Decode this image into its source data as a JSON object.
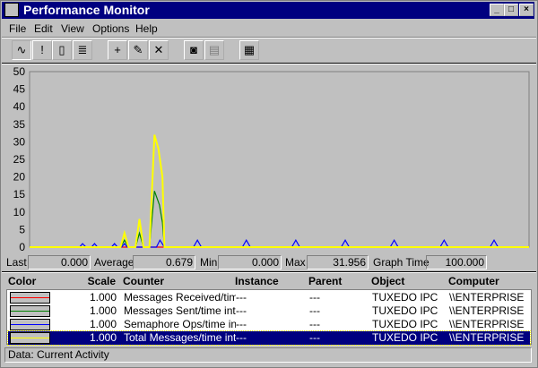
{
  "window": {
    "title": "Performance Monitor",
    "controls": [
      "_",
      "□",
      "×"
    ]
  },
  "menu": [
    "File",
    "Edit",
    "View",
    "Options",
    "Help"
  ],
  "toolbar": [
    {
      "name": "chart-view"
    },
    {
      "name": "alert-view"
    },
    {
      "name": "log-view"
    },
    {
      "name": "report-view"
    },
    {
      "name": "add-counter",
      "glyph": "+"
    },
    {
      "name": "edit-counter"
    },
    {
      "name": "delete-counter",
      "glyph": "✕"
    },
    {
      "name": "update-now"
    },
    {
      "name": "bookmark"
    },
    {
      "name": "options"
    }
  ],
  "stats": {
    "last_label": "Last",
    "last": "0.000",
    "average_label": "Average",
    "average": "0.679",
    "min_label": "Min",
    "min": "0.000",
    "max_label": "Max",
    "max": "31.956",
    "graph_time_label": "Graph Time",
    "graph_time": "100.000"
  },
  "legend": {
    "headers": {
      "color": "Color",
      "scale": "Scale",
      "counter": "Counter",
      "instance": "Instance",
      "parent": "Parent",
      "object": "Object",
      "computer": "Computer"
    },
    "rows": [
      {
        "color": "#ff0000",
        "scale": "1.000",
        "counter": "Messages Received/time",
        "instance": "---",
        "parent": "---",
        "object": "TUXEDO IPC",
        "computer": "\\\\ENTERPRISE"
      },
      {
        "color": "#008000",
        "scale": "1.000",
        "counter": "Messages Sent/time interv",
        "instance": "---",
        "parent": "---",
        "object": "TUXEDO IPC",
        "computer": "\\\\ENTERPRISE"
      },
      {
        "color": "#0000ff",
        "scale": "1.000",
        "counter": "Semaphore Ops/time inter",
        "instance": "---",
        "parent": "---",
        "object": "TUXEDO IPC",
        "computer": "\\\\ENTERPRISE"
      },
      {
        "color": "#ffff00",
        "scale": "1.000",
        "counter": "Total Messages/time inter",
        "instance": "---",
        "parent": "---",
        "object": "TUXEDO IPC",
        "computer": "\\\\ENTERPRISE",
        "selected": true
      }
    ]
  },
  "status": "Data: Current Activity",
  "chart_data": {
    "type": "line",
    "ylim": [
      0,
      50
    ],
    "xlim": [
      0,
      100
    ],
    "yticks": [
      "0",
      "5",
      "10",
      "15",
      "20",
      "25",
      "30",
      "35",
      "40",
      "45",
      "50"
    ],
    "series": [
      {
        "name": "Messages Received/time",
        "color": "#ff0000",
        "points": [
          [
            0,
            0
          ],
          [
            100,
            0
          ]
        ]
      },
      {
        "name": "Semaphore Ops/time",
        "color": "#0000ff",
        "points": [
          [
            0,
            0
          ],
          [
            10,
            0
          ],
          [
            10.6,
            1
          ],
          [
            11.3,
            0
          ],
          [
            12.4,
            0
          ],
          [
            13,
            1
          ],
          [
            13.6,
            0
          ],
          [
            16.4,
            0
          ],
          [
            17,
            1
          ],
          [
            17.6,
            0
          ],
          [
            18.4,
            0
          ],
          [
            19,
            1
          ],
          [
            19.6,
            0
          ],
          [
            25.4,
            0
          ],
          [
            26.1,
            2
          ],
          [
            27,
            0
          ],
          [
            32.8,
            0
          ],
          [
            33.6,
            2
          ],
          [
            34.4,
            0
          ],
          [
            42.6,
            0
          ],
          [
            43.4,
            2
          ],
          [
            44.2,
            0
          ],
          [
            52.5,
            0
          ],
          [
            53.3,
            2
          ],
          [
            54.1,
            0
          ],
          [
            62.4,
            0
          ],
          [
            63.2,
            2
          ],
          [
            64,
            0
          ],
          [
            72.2,
            0
          ],
          [
            73,
            2
          ],
          [
            73.8,
            0
          ],
          [
            82.2,
            0
          ],
          [
            83,
            2
          ],
          [
            83.8,
            0
          ],
          [
            92.2,
            0
          ],
          [
            93,
            2
          ],
          [
            93.8,
            0
          ],
          [
            100,
            0
          ]
        ]
      },
      {
        "name": "Messages Sent/time",
        "color": "#008000",
        "points": [
          [
            0,
            0
          ],
          [
            18.2,
            0
          ],
          [
            19,
            2
          ],
          [
            19.8,
            0
          ],
          [
            21.2,
            0
          ],
          [
            22,
            4
          ],
          [
            22.8,
            0
          ],
          [
            24,
            0
          ],
          [
            25,
            16
          ],
          [
            26,
            12
          ],
          [
            26.6,
            7
          ],
          [
            27,
            0
          ],
          [
            100,
            0
          ]
        ]
      },
      {
        "name": "Total Messages/time",
        "color": "#ffff00",
        "points": [
          [
            0,
            0
          ],
          [
            18.2,
            0
          ],
          [
            19,
            4
          ],
          [
            19.8,
            0
          ],
          [
            21.2,
            0
          ],
          [
            22,
            8
          ],
          [
            22.8,
            0
          ],
          [
            24,
            0
          ],
          [
            25,
            32
          ],
          [
            25.8,
            28
          ],
          [
            26.6,
            20
          ],
          [
            27,
            0
          ],
          [
            100,
            0
          ]
        ]
      }
    ]
  }
}
